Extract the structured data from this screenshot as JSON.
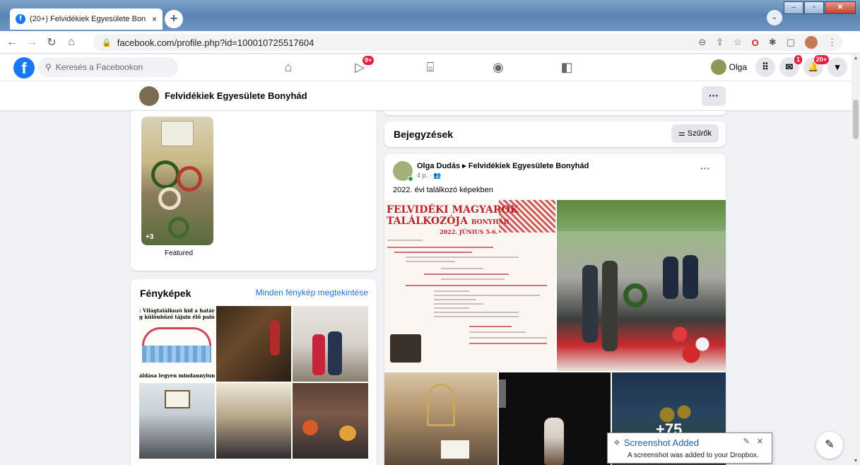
{
  "browser": {
    "tab_title": "(20+) Felvidékiek Egyesülete Bon",
    "tab_close": "×",
    "new_tab": "+",
    "url": "facebook.com/profile.php?id=100010725517604",
    "window_buttons": [
      "–",
      "▫",
      "✕"
    ]
  },
  "fbnav": {
    "search_placeholder": "Keresés a Facebookon",
    "watch_badge": "9+",
    "profile_name": "Olga",
    "messenger_badge": "1",
    "notifications_badge": "20+"
  },
  "page_header": {
    "name": "Felvidékiek Egyesülete Bonyhád",
    "more": "···"
  },
  "featured": {
    "count_label": "+3",
    "label": "Featured"
  },
  "photos": {
    "title": "Fényképek",
    "see_all": "Minden fénykép megtekintése",
    "photo1_text_top": ": Világtalálkozó híd a határon t",
    "photo1_text_top2": "g különböző tájain élő palócok",
    "photo1_text_bottom": "áldása legyen mindannyiunk"
  },
  "posts": {
    "title": "Bejegyzések",
    "filter_label": "⚌ Szűrők"
  },
  "post": {
    "author": "Olga Dudás ▸ Felvidékiek Egyesülete Bonyhád",
    "meta": "4 p. · 👥",
    "more": "···",
    "text": "2022. évi találkozó képekben",
    "poster_title_1": "FELVIDÉKI MAGYAROK",
    "poster_title_2": "TALÁLKOZÓJA",
    "poster_city": "BONYHÁD",
    "poster_date": "2022. JÚNIUS 5-6.",
    "more_photos": "+75"
  },
  "toast": {
    "title": "Screenshot Added",
    "body": "A screenshot was added to your Dropbox.",
    "pin_icon": "✎",
    "close_icon": "✕"
  },
  "colors": {
    "fb_blue": "#1877f2",
    "badge_red": "#e41e3f",
    "link_blue": "#216fdb"
  }
}
